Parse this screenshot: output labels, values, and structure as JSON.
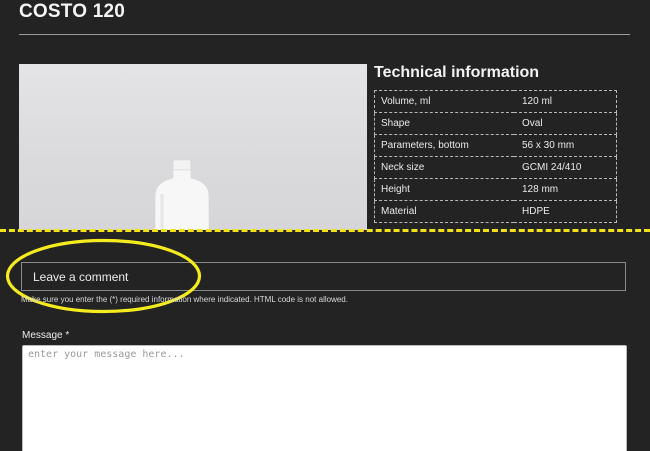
{
  "product": {
    "title": "COSTO 120",
    "image_alt": "White bottle"
  },
  "technical": {
    "title": "Technical information",
    "rows": [
      {
        "label": "Volume, ml",
        "value": "120 ml"
      },
      {
        "label": "Shape",
        "value": "Oval"
      },
      {
        "label": "Parameters, bottom",
        "value": "56 x 30 mm"
      },
      {
        "label": "Neck size",
        "value": "GCMI 24/410"
      },
      {
        "label": "Height",
        "value": "128 mm"
      },
      {
        "label": "Material",
        "value": "HDPE"
      }
    ]
  },
  "comment": {
    "heading": "Leave a comment",
    "notice": "Make sure you enter the (*) required information where indicated. HTML code is not allowed.",
    "message_label": "Message *",
    "message_placeholder": "enter your message here..."
  },
  "annotations": {
    "fold_line_color": "#f2e21a",
    "highlight_color": "#f5ec1f"
  },
  "colors": {
    "background": "#232323",
    "text": "#e8e8e8"
  }
}
